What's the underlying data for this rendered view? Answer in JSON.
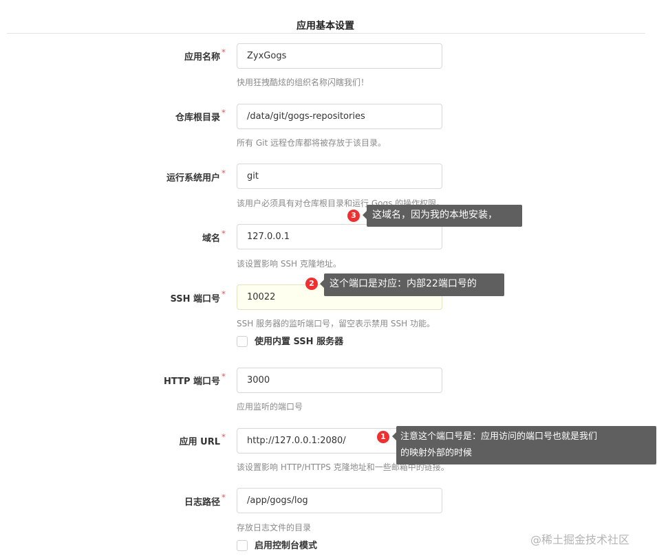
{
  "section_title": "应用基本设置",
  "fields": {
    "app_name": {
      "label": "应用名称",
      "required": "*",
      "value": "ZyxGogs",
      "help": "快用狂拽酷炫的组织名称闪瞎我们！"
    },
    "repo_root": {
      "label": "仓库根目录",
      "required": "*",
      "value": "/data/git/gogs-repositories",
      "help": "所有 Git 远程仓库都将被存放于该目录。"
    },
    "run_user": {
      "label": "运行系统用户",
      "required": "*",
      "value": "git",
      "help": "该用户必须具有对仓库根目录和运行 Gogs 的操作权限。"
    },
    "domain": {
      "label": "域名",
      "required": "*",
      "value": "127.0.0.1",
      "help": "该设置影响 SSH 克隆地址。"
    },
    "ssh_port": {
      "label": "SSH 端口号",
      "required": "*",
      "value": "10022",
      "help": "SSH 服务器的监听端口号，留空表示禁用 SSH 功能。"
    },
    "http_port": {
      "label": "HTTP 端口号",
      "required": "*",
      "value": "3000",
      "help": "应用监听的端口号"
    },
    "app_url": {
      "label": "应用 URL",
      "required": "*",
      "value": "http://127.0.0.1:2080/",
      "help": "该设置影响 HTTP/HTTPS 克隆地址和一些邮箱中的链接。"
    },
    "log_path": {
      "label": "日志路径",
      "required": "*",
      "value": "/app/gogs/log",
      "help": "存放日志文件的目录"
    }
  },
  "checkboxes": {
    "builtin_ssh": {
      "label": "使用内置 SSH 服务器",
      "checked": false
    },
    "console_mode": {
      "label": "启用控制台模式",
      "checked": false
    }
  },
  "annotations": {
    "note1": {
      "number": "1",
      "line1": "注意这个端口号是：应用访问的端口号也就是我们",
      "line2": "的映射外部的时候"
    },
    "note2": {
      "number": "2",
      "text": "这个端口是对应：内部22端口号的"
    },
    "note3": {
      "number": "3",
      "text": "这域名，因为我的本地安装，"
    }
  },
  "watermark": "@稀土掘金技术社区",
  "colors": {
    "required_star": "#d95c5c",
    "annotation_bg": "#5f5f5f",
    "badge_red": "#ee3030",
    "focused_input_bg": "#fffff0"
  }
}
